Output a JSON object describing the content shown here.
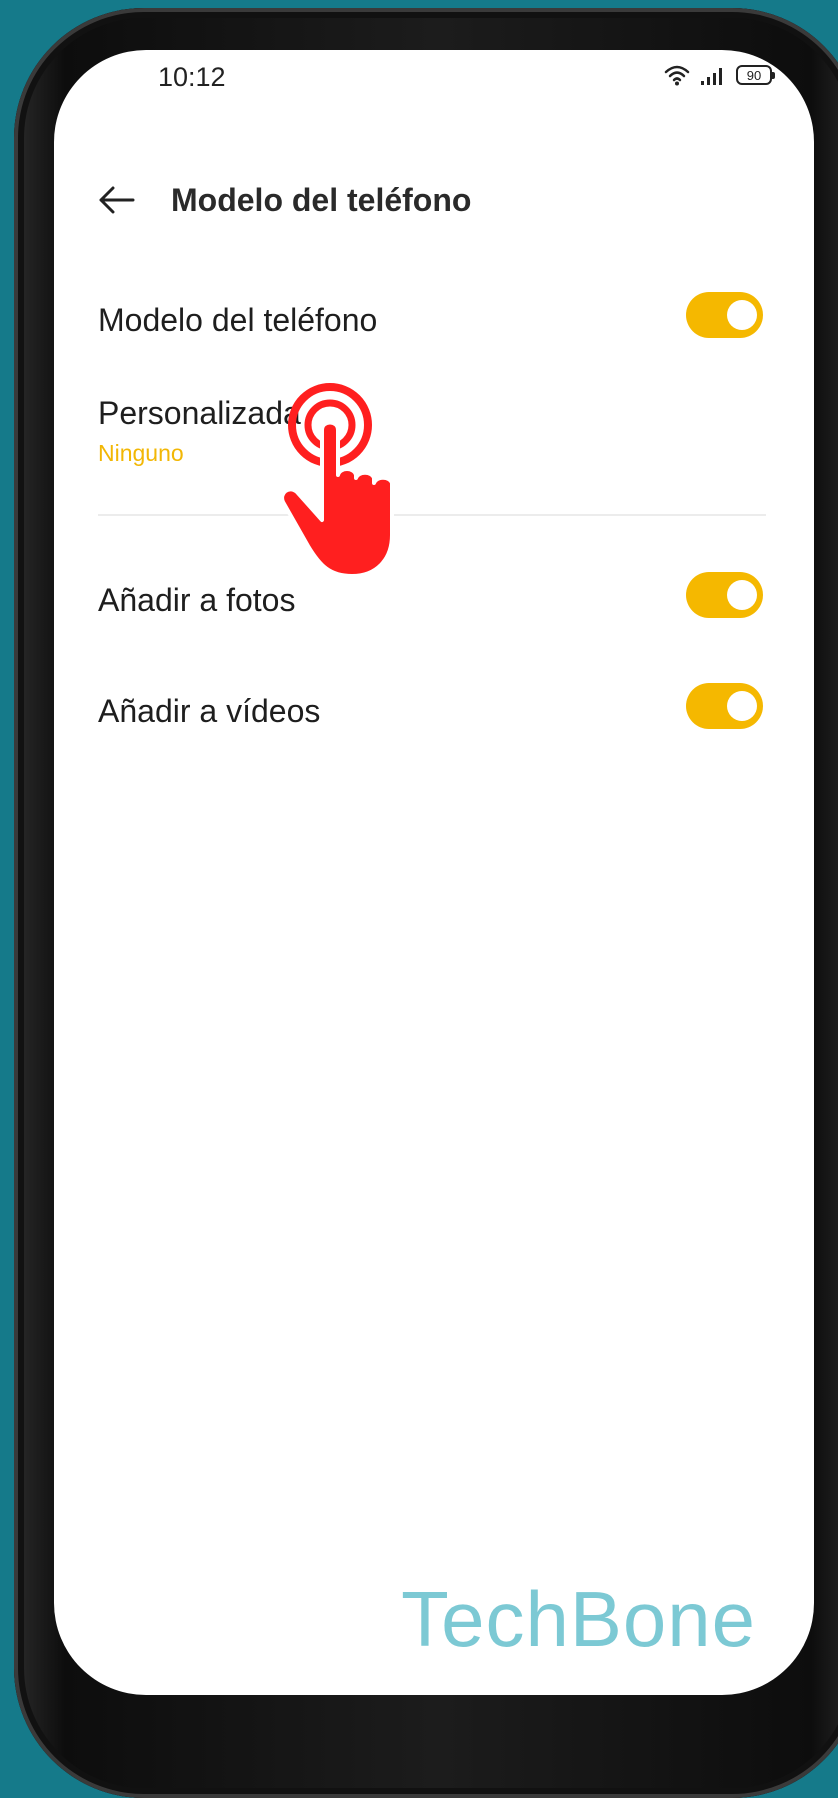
{
  "status_bar": {
    "time": "10:12",
    "battery_level": "90",
    "icons": [
      "wifi-icon",
      "signal-icon",
      "battery-icon"
    ]
  },
  "app_bar": {
    "title": "Modelo del teléfono",
    "back_icon": "arrow-left-icon"
  },
  "settings": [
    {
      "label": "Modelo del teléfono",
      "toggle": true
    },
    {
      "label": "Personalizada",
      "subtitle": "Ninguno"
    },
    {
      "label": "Añadir a fotos",
      "toggle": true
    },
    {
      "label": "Añadir a vídeos",
      "toggle": true
    }
  ],
  "colors": {
    "accent": "#f5b800",
    "subtitle": "#f2b705",
    "frame_background": "#157a8a",
    "tap_indicator": "#ff1f1f"
  },
  "overlay": {
    "tap_indicator_icon": "tap-hand-icon",
    "watermark": "TechBone"
  }
}
